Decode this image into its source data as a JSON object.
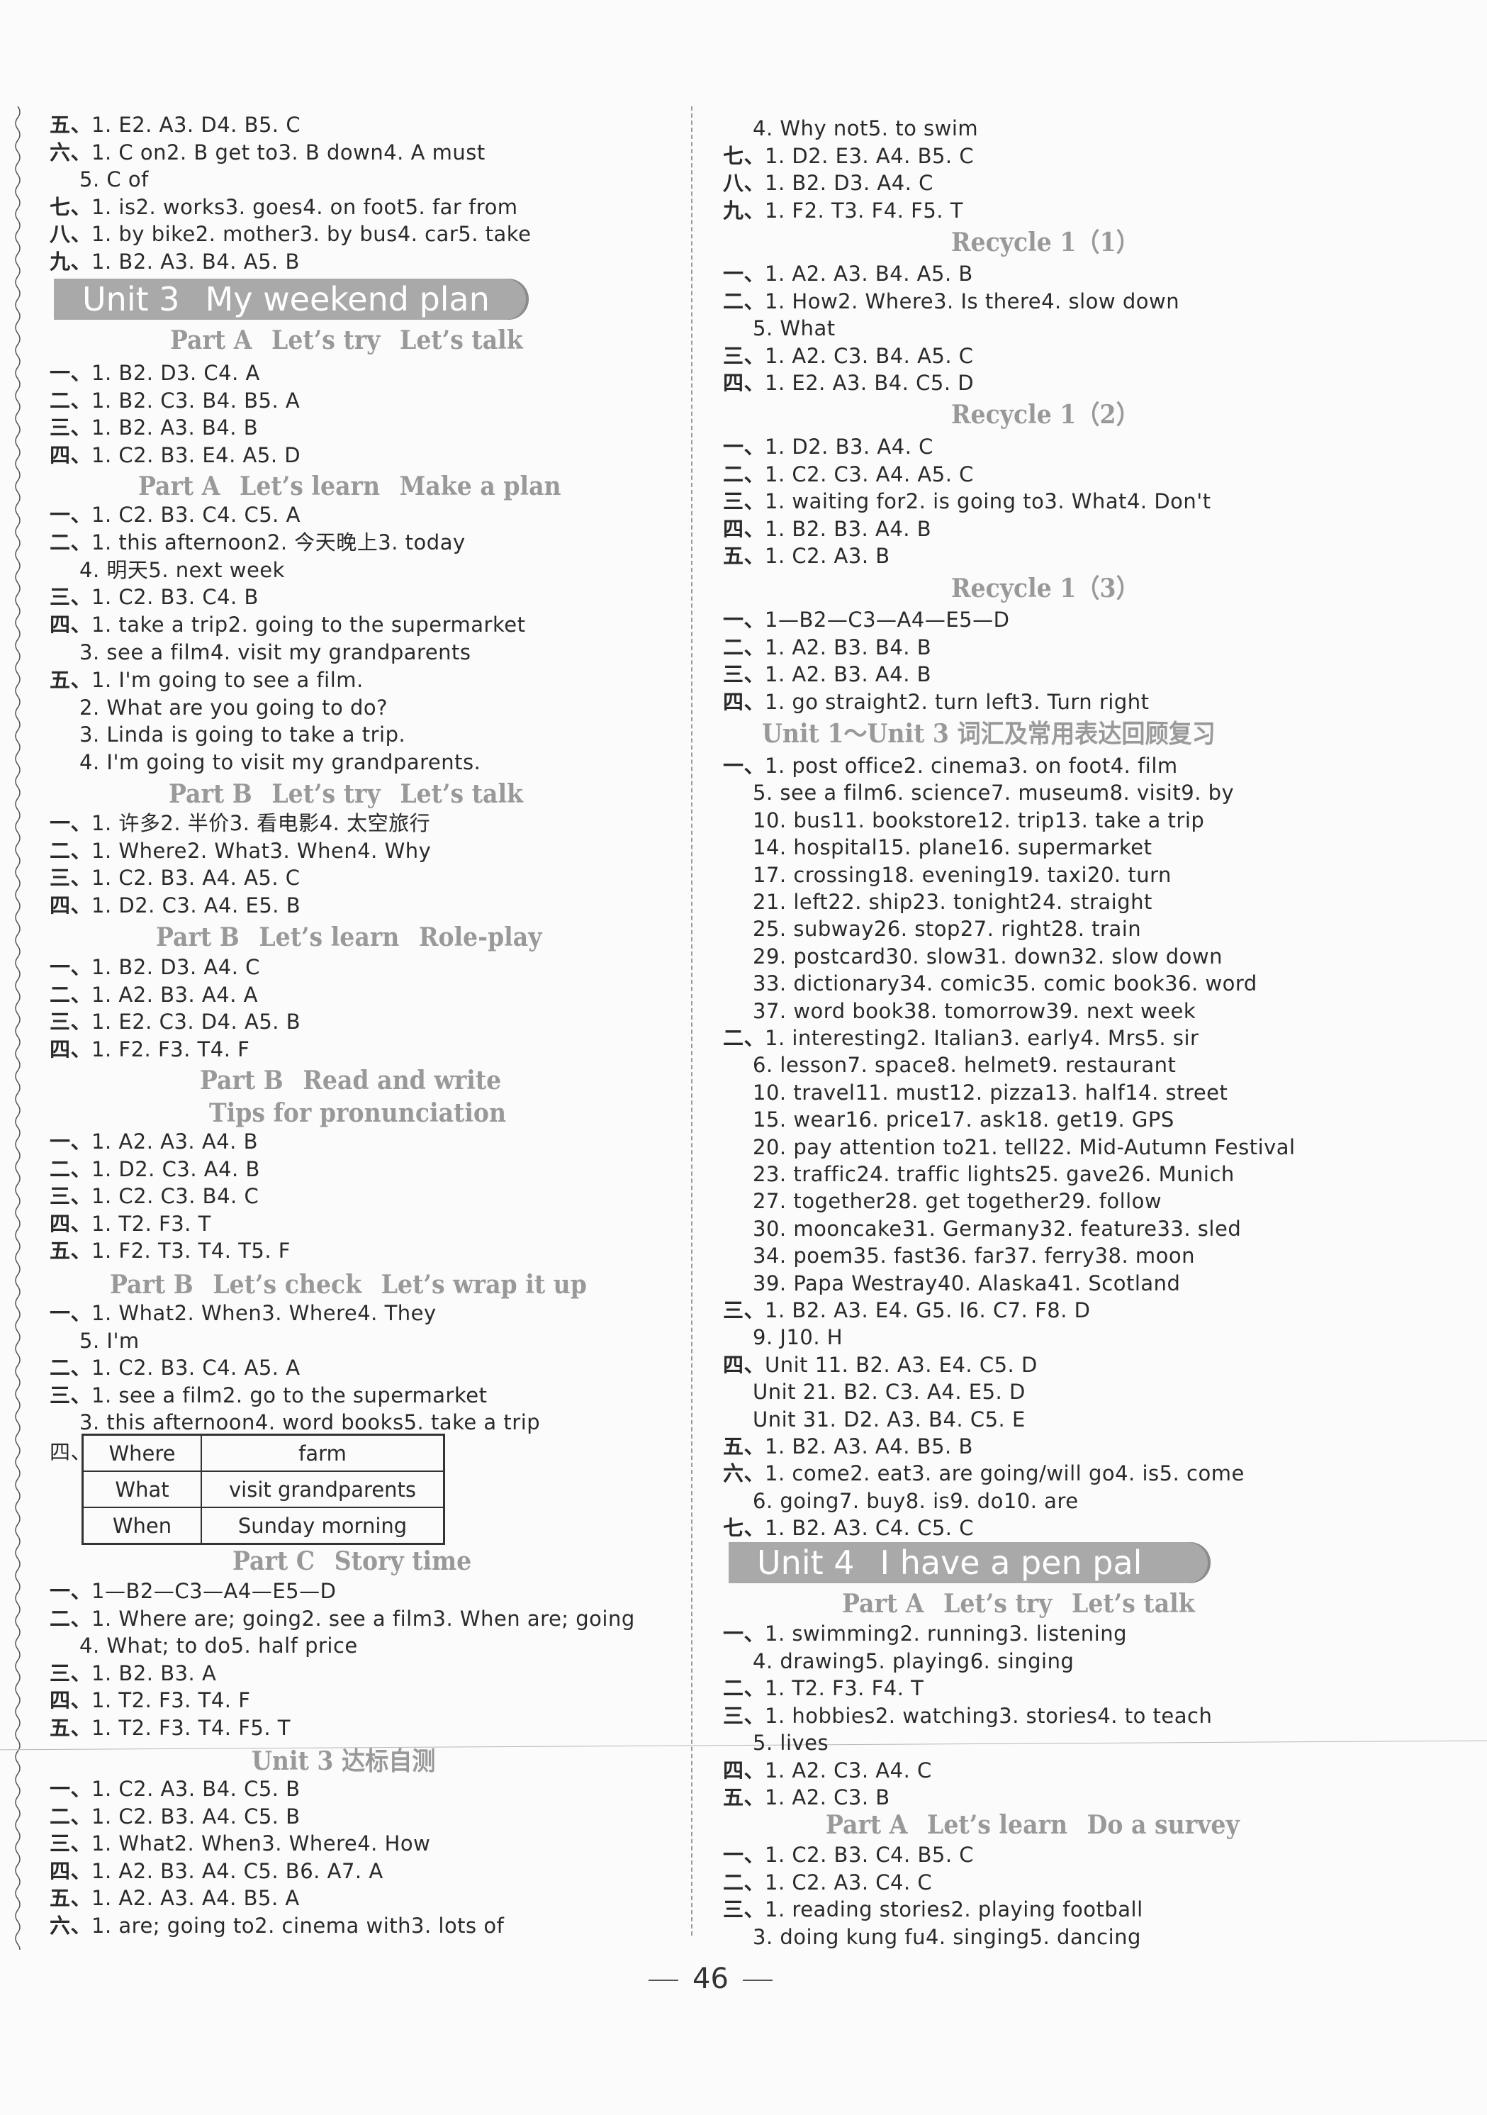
{
  "page_number": "46",
  "left": {
    "top_lines": [
      {
        "sec": "五、",
        "items": [
          "1. E",
          "2. A",
          "3. D",
          "4. B",
          "5. C"
        ]
      },
      {
        "sec": "六、",
        "items": [
          "1. C  on",
          "2. B  get to",
          "3. B  down",
          "4. A  must"
        ]
      },
      {
        "sec": "",
        "items": [
          "5. C  of"
        ]
      },
      {
        "sec": "七、",
        "items": [
          "1. is",
          "2. works",
          "3. goes",
          "4. on foot",
          "5. far from"
        ]
      },
      {
        "sec": "八、",
        "items": [
          "1. by bike",
          "2. mother",
          "3. by bus",
          "4. car",
          "5. take"
        ]
      },
      {
        "sec": "九、",
        "items": [
          "1. B",
          "2. A",
          "3. B",
          "4. A",
          "5. B"
        ]
      }
    ],
    "banner": {
      "unit": "Unit 3",
      "title": "My weekend plan"
    },
    "headings": {
      "a_try_talk": {
        "part": "Part A",
        "t1": "Let’s try",
        "t2": "Let’s talk"
      },
      "a_learn_plan": {
        "part": "Part A",
        "t1": "Let’s learn",
        "t2": "Make a plan"
      },
      "b_try_talk": {
        "part": "Part B",
        "t1": "Let’s try",
        "t2": "Let’s talk"
      },
      "b_learn_role": {
        "part": "Part B",
        "t1": "Let’s learn",
        "t2": "Role-play"
      },
      "b_read_write": {
        "part": "Part B",
        "t1": "Read and write"
      },
      "b_tips": {
        "t1": "Tips for pronunciation"
      },
      "b_check_wrap": {
        "part": "Part B",
        "t1": "Let’s check",
        "t2": "Let’s wrap it up"
      },
      "c_story": {
        "part": "Part C",
        "t1": "Story time"
      },
      "unit3_test": {
        "t1": "Unit 3 达标自测"
      }
    },
    "a_try_talk": [
      {
        "sec": "一、",
        "items": [
          "1. B",
          "2. D",
          "3. C",
          "4. A"
        ]
      },
      {
        "sec": "二、",
        "items": [
          "1. B",
          "2. C",
          "3. B",
          "4. B",
          "5. A"
        ]
      },
      {
        "sec": "三、",
        "items": [
          "1. B",
          "2. A",
          "3. B",
          "4. B"
        ]
      },
      {
        "sec": "四、",
        "items": [
          "1. C",
          "2. B",
          "3. E",
          "4. A",
          "5. D"
        ]
      }
    ],
    "a_learn_plan": [
      {
        "sec": "一、",
        "items": [
          "1. C",
          "2. B",
          "3. C",
          "4. C",
          "5. A"
        ]
      },
      {
        "sec": "二、",
        "items": [
          "1. this afternoon",
          "2. 今天晚上",
          "3. today"
        ]
      },
      {
        "sec": "",
        "items": [
          "4. 明天",
          "5. next week"
        ]
      },
      {
        "sec": "三、",
        "items": [
          "1. C",
          "2. B",
          "3. C",
          "4. B"
        ]
      },
      {
        "sec": "四、",
        "items": [
          "1. take a trip",
          "2. going to the supermarket"
        ]
      },
      {
        "sec": "",
        "items": [
          "3. see a film",
          "4. visit my grandparents"
        ]
      },
      {
        "sec": "五、",
        "items": [
          "1. I'm going to see a film."
        ]
      },
      {
        "sec": "",
        "items": [
          "2. What are you going to do?"
        ]
      },
      {
        "sec": "",
        "items": [
          "3. Linda is going to take a trip."
        ]
      },
      {
        "sec": "",
        "items": [
          "4. I'm going to visit my grandparents."
        ]
      }
    ],
    "b_try_talk": [
      {
        "sec": "一、",
        "items": [
          "1. 许多",
          "2. 半价",
          "3. 看电影",
          "4. 太空旅行"
        ]
      },
      {
        "sec": "二、",
        "items": [
          "1. Where",
          "2. What",
          "3. When",
          "4. Why"
        ]
      },
      {
        "sec": "三、",
        "items": [
          "1. C",
          "2. B",
          "3. A",
          "4. A",
          "5. C"
        ]
      },
      {
        "sec": "四、",
        "items": [
          "1. D",
          "2. C",
          "3. A",
          "4. E",
          "5. B"
        ]
      }
    ],
    "b_learn_role": [
      {
        "sec": "一、",
        "items": [
          "1. B",
          "2. D",
          "3. A",
          "4. C"
        ]
      },
      {
        "sec": "二、",
        "items": [
          "1. A",
          "2. B",
          "3. A",
          "4. A"
        ]
      },
      {
        "sec": "三、",
        "items": [
          "1. E",
          "2. C",
          "3. D",
          "4. A",
          "5. B"
        ]
      },
      {
        "sec": "四、",
        "items": [
          "1. F",
          "2. F",
          "3. T",
          "4. F"
        ]
      }
    ],
    "b_read_write": [
      {
        "sec": "一、",
        "items": [
          "1. A",
          "2. A",
          "3. A",
          "4. B"
        ]
      },
      {
        "sec": "二、",
        "items": [
          "1. D",
          "2. C",
          "3. A",
          "4. B"
        ]
      },
      {
        "sec": "三、",
        "items": [
          "1. C",
          "2. C",
          "3. B",
          "4. C"
        ]
      },
      {
        "sec": "四、",
        "items": [
          "1. T",
          "2. F",
          "3. T"
        ]
      },
      {
        "sec": "五、",
        "items": [
          "1. F",
          "2. T",
          "3. T",
          "4. T",
          "5. F"
        ]
      }
    ],
    "b_check_wrap": [
      {
        "sec": "一、",
        "items": [
          "1. What",
          "2. When",
          "3. Where",
          "4. They"
        ]
      },
      {
        "sec": "",
        "items": [
          "5. I'm"
        ]
      },
      {
        "sec": "二、",
        "items": [
          "1. C",
          "2. B",
          "3. C",
          "4. A",
          "5. A"
        ]
      },
      {
        "sec": "三、",
        "items": [
          "1. see a film",
          "2. go to the supermarket"
        ]
      },
      {
        "sec": "",
        "items": [
          "3. this afternoon",
          "4. word books",
          "5. take a trip"
        ]
      }
    ],
    "plan_table": {
      "sec": "四、",
      "rows": [
        {
          "key": "Where",
          "value": "farm"
        },
        {
          "key": "What",
          "value": "visit grandparents"
        },
        {
          "key": "When",
          "value": "Sunday morning"
        }
      ]
    },
    "c_story": [
      {
        "sec": "一、",
        "items": [
          "1—B",
          "2—C",
          "3—A",
          "4—E",
          "5—D"
        ]
      },
      {
        "sec": "二、",
        "items": [
          "1. Where are; going",
          "2. see a film",
          "3. When are; going"
        ]
      },
      {
        "sec": "",
        "items": [
          "4. What; to do",
          "5. half price"
        ]
      },
      {
        "sec": "三、",
        "items": [
          "1. B",
          "2. B",
          "3. A"
        ]
      },
      {
        "sec": "四、",
        "items": [
          "1. T",
          "2. F",
          "3. T",
          "4. F"
        ]
      },
      {
        "sec": "五、",
        "items": [
          "1. T",
          "2. F",
          "3. T",
          "4. F",
          "5. T"
        ]
      }
    ],
    "unit3_test": [
      {
        "sec": "一、",
        "items": [
          "1. C",
          "2. A",
          "3. B",
          "4. C",
          "5. B"
        ]
      },
      {
        "sec": "二、",
        "items": [
          "1. C",
          "2. B",
          "3. A",
          "4. C",
          "5. B"
        ]
      },
      {
        "sec": "三、",
        "items": [
          "1. What",
          "2. When",
          "3. Where",
          "4. How"
        ]
      },
      {
        "sec": "四、",
        "items": [
          "1. A",
          "2. B",
          "3. A",
          "4. C",
          "5. B",
          "6. A",
          "7. A"
        ]
      },
      {
        "sec": "五、",
        "items": [
          "1. A",
          "2. A",
          "3. A",
          "4. B",
          "5. A"
        ]
      },
      {
        "sec": "六、",
        "items": [
          "1. are; going to",
          "2. cinema with",
          "3. lots of"
        ]
      }
    ]
  },
  "right": {
    "top_lines": [
      {
        "sec": "",
        "items": [
          "4. Why not",
          "5. to swim"
        ]
      },
      {
        "sec": "七、",
        "items": [
          "1. D",
          "2. E",
          "3. A",
          "4. B",
          "5. C"
        ]
      },
      {
        "sec": "八、",
        "items": [
          "1. B",
          "2. D",
          "3. A",
          "4. C"
        ]
      },
      {
        "sec": "九、",
        "items": [
          "1. F",
          "2. T",
          "3. F",
          "4. F",
          "5. T"
        ]
      }
    ],
    "headings": {
      "recycle1": "Recycle 1（1）",
      "recycle2": "Recycle 1（2）",
      "recycle3": "Recycle 1（3）",
      "review": "Unit 1～Unit 3 词汇及常用表达回顾复习",
      "u4_try_talk": {
        "part": "Part A",
        "t1": "Let’s try",
        "t2": "Let’s talk"
      },
      "u4_learn_survey": {
        "part": "Part A",
        "t1": "Let’s learn",
        "t2": "Do a survey"
      }
    },
    "recycle1": [
      {
        "sec": "一、",
        "items": [
          "1. A",
          "2. A",
          "3. B",
          "4. A",
          "5. B"
        ]
      },
      {
        "sec": "二、",
        "items": [
          "1. How",
          "2. Where",
          "3. Is there",
          "4. slow down"
        ]
      },
      {
        "sec": "",
        "items": [
          "5. What"
        ]
      },
      {
        "sec": "三、",
        "items": [
          "1. A",
          "2. C",
          "3. B",
          "4. A",
          "5. C"
        ]
      },
      {
        "sec": "四、",
        "items": [
          "1. E",
          "2. A",
          "3. B",
          "4. C",
          "5. D"
        ]
      }
    ],
    "recycle2": [
      {
        "sec": "一、",
        "items": [
          "1. D",
          "2. B",
          "3. A",
          "4. C"
        ]
      },
      {
        "sec": "二、",
        "items": [
          "1. C",
          "2. C",
          "3. A",
          "4. A",
          "5. C"
        ]
      },
      {
        "sec": "三、",
        "items": [
          "1. waiting for",
          "2. is going to",
          "3. What",
          "4. Don't"
        ]
      },
      {
        "sec": "四、",
        "items": [
          "1. B",
          "2. B",
          "3. A",
          "4. B"
        ]
      },
      {
        "sec": "五、",
        "items": [
          "1. C",
          "2. A",
          "3. B"
        ]
      }
    ],
    "recycle3": [
      {
        "sec": "一、",
        "items": [
          "1—B",
          "2—C",
          "3—A",
          "4—E",
          "5—D"
        ]
      },
      {
        "sec": "二、",
        "items": [
          "1. A",
          "2. B",
          "3. B",
          "4. B"
        ]
      },
      {
        "sec": "三、",
        "items": [
          "1. A",
          "2. B",
          "3. A",
          "4. B"
        ]
      },
      {
        "sec": "四、",
        "items": [
          "1. go straight",
          "2. turn left",
          "3. Turn right"
        ]
      }
    ],
    "review": [
      {
        "sec": "一、",
        "items": [
          "1. post office",
          "2. cinema",
          "3. on foot",
          "4. film"
        ]
      },
      {
        "sec": "",
        "items": [
          "5. see a film",
          "6. science",
          "7. museum",
          "8. visit",
          "9. by"
        ]
      },
      {
        "sec": "",
        "items": [
          "10. bus",
          "11. bookstore",
          "12. trip",
          "13. take a trip"
        ]
      },
      {
        "sec": "",
        "items": [
          "14. hospital",
          "15. plane",
          "16. supermarket"
        ]
      },
      {
        "sec": "",
        "items": [
          "17. crossing",
          "18. evening",
          "19. taxi",
          "20. turn"
        ]
      },
      {
        "sec": "",
        "items": [
          "21. left",
          "22. ship",
          "23. tonight",
          "24. straight"
        ]
      },
      {
        "sec": "",
        "items": [
          "25. subway",
          "26. stop",
          "27. right",
          "28. train"
        ]
      },
      {
        "sec": "",
        "items": [
          "29. postcard",
          "30. slow",
          "31. down",
          "32. slow down"
        ]
      },
      {
        "sec": "",
        "items": [
          "33. dictionary",
          "34. comic",
          "35. comic book",
          "36. word"
        ]
      },
      {
        "sec": "",
        "items": [
          "37. word book",
          "38. tomorrow",
          "39. next week"
        ]
      },
      {
        "sec": "二、",
        "items": [
          "1. interesting",
          "2. Italian",
          "3. early",
          "4. Mrs",
          "5. sir"
        ]
      },
      {
        "sec": "",
        "items": [
          "6. lesson",
          "7. space",
          "8. helmet",
          "9. restaurant"
        ]
      },
      {
        "sec": "",
        "items": [
          "10. travel",
          "11. must",
          "12. pizza",
          "13. half",
          "14. street"
        ]
      },
      {
        "sec": "",
        "items": [
          "15. wear",
          "16. price",
          "17. ask",
          "18. get",
          "19. GPS"
        ]
      },
      {
        "sec": "",
        "items": [
          "20. pay attention to",
          "21. tell",
          "22. Mid-Autumn Festival"
        ]
      },
      {
        "sec": "",
        "items": [
          "23. traffic",
          "24. traffic lights",
          "25. gave",
          "26. Munich"
        ]
      },
      {
        "sec": "",
        "items": [
          "27. together",
          "28. get together",
          "29. follow"
        ]
      },
      {
        "sec": "",
        "items": [
          "30. mooncake",
          "31. Germany",
          "32. feature",
          "33. sled"
        ]
      },
      {
        "sec": "",
        "items": [
          "34. poem",
          "35. fast",
          "36. far",
          "37. ferry",
          "38. moon"
        ]
      },
      {
        "sec": "",
        "items": [
          "39. Papa Westray",
          "40. Alaska",
          "41. Scotland"
        ]
      },
      {
        "sec": "三、",
        "items": [
          "1. B",
          "2. A",
          "3. E",
          "4. G",
          "5. I",
          "6. C",
          "7. F",
          "8. D"
        ]
      },
      {
        "sec": "",
        "items": [
          "9. J",
          "10. H"
        ]
      },
      {
        "sec": "四、",
        "items": [
          "Unit 1",
          "1. B",
          "2. A",
          "3. E",
          "4. C",
          "5. D"
        ]
      },
      {
        "sec": "",
        "items": [
          "Unit 2",
          "1. B",
          "2. C",
          "3. A",
          "4. E",
          "5. D"
        ]
      },
      {
        "sec": "",
        "items": [
          "Unit 3",
          "1. D",
          "2. A",
          "3. B",
          "4. C",
          "5. E"
        ]
      },
      {
        "sec": "五、",
        "items": [
          "1. B",
          "2. A",
          "3. A",
          "4. B",
          "5. B"
        ]
      },
      {
        "sec": "六、",
        "items": [
          "1. come",
          "2. eat",
          "3. are going/will go",
          "4. is",
          "5. come"
        ]
      },
      {
        "sec": "",
        "items": [
          "6. going",
          "7. buy",
          "8. is",
          "9. do",
          "10. are"
        ]
      },
      {
        "sec": "七、",
        "items": [
          "1. B",
          "2. A",
          "3. C",
          "4. C",
          "5. C"
        ]
      }
    ],
    "banner": {
      "unit": "Unit 4",
      "title": "I have a pen pal"
    },
    "u4_try_talk": [
      {
        "sec": "一、",
        "items": [
          "1. swimming",
          "2. running",
          "3. listening"
        ]
      },
      {
        "sec": "",
        "items": [
          "4. drawing",
          "5. playing",
          "6. singing"
        ]
      },
      {
        "sec": "二、",
        "items": [
          "1. T",
          "2. F",
          "3. F",
          "4. T"
        ]
      },
      {
        "sec": "三、",
        "items": [
          "1. hobbies",
          "2. watching",
          "3. stories",
          "4. to teach"
        ]
      },
      {
        "sec": "",
        "items": [
          "5. lives"
        ]
      },
      {
        "sec": "四、",
        "items": [
          "1. A",
          "2. C",
          "3. A",
          "4. C"
        ]
      },
      {
        "sec": "五、",
        "items": [
          "1. A",
          "2. C",
          "3. B"
        ]
      }
    ],
    "u4_learn_survey": [
      {
        "sec": "一、",
        "items": [
          "1. C",
          "2. B",
          "3. C",
          "4. B",
          "5. C"
        ]
      },
      {
        "sec": "二、",
        "items": [
          "1. C",
          "2. A",
          "3. C",
          "4. C"
        ]
      },
      {
        "sec": "三、",
        "items": [
          "1. reading stories",
          "2. playing football"
        ]
      },
      {
        "sec": "",
        "items": [
          "3. doing kung fu",
          "4. singing",
          "5. dancing"
        ]
      }
    ]
  }
}
